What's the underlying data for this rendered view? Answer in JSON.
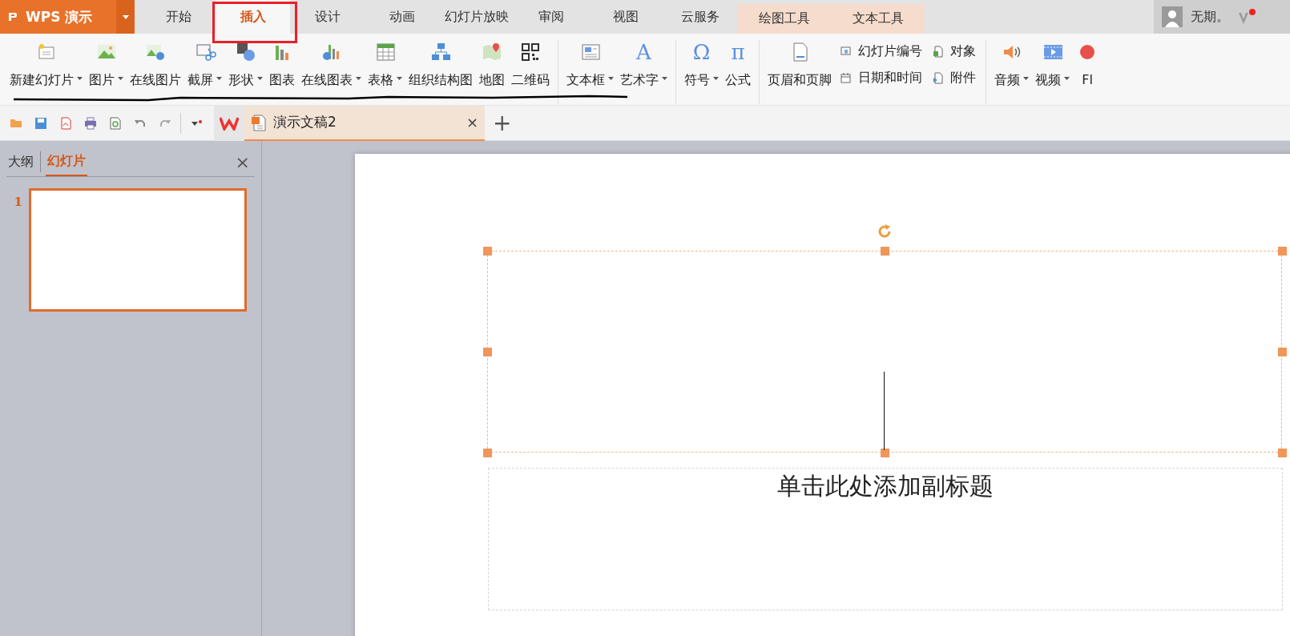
{
  "app": {
    "logo": "WPS 演示"
  },
  "tabs": [
    {
      "label": "开始",
      "selected": false,
      "contextual": false
    },
    {
      "label": "插入",
      "selected": true,
      "contextual": false
    },
    {
      "label": "设计",
      "selected": false,
      "contextual": false
    },
    {
      "label": "动画",
      "selected": false,
      "contextual": false
    },
    {
      "label": "幻灯片放映",
      "selected": false,
      "contextual": false
    },
    {
      "label": "审阅",
      "selected": false,
      "contextual": false
    },
    {
      "label": "视图",
      "selected": false,
      "contextual": false
    },
    {
      "label": "云服务",
      "selected": false,
      "contextual": false
    },
    {
      "label": "绘图工具",
      "selected": false,
      "contextual": true
    },
    {
      "label": "文本工具",
      "selected": false,
      "contextual": true
    }
  ],
  "user": {
    "name": "无期。"
  },
  "ribbon": [
    {
      "items": [
        {
          "kind": "big",
          "label": "新建幻灯片",
          "dropdown": true
        },
        {
          "kind": "big",
          "label": "图片",
          "dropdown": true
        },
        {
          "kind": "big",
          "label": "在线图片",
          "dropdown": false
        },
        {
          "kind": "big",
          "label": "截屏",
          "dropdown": true
        },
        {
          "kind": "big",
          "label": "形状",
          "dropdown": true
        },
        {
          "kind": "big",
          "label": "图表",
          "dropdown": false
        },
        {
          "kind": "big",
          "label": "在线图表",
          "dropdown": true
        },
        {
          "kind": "big",
          "label": "表格",
          "dropdown": true
        },
        {
          "kind": "big",
          "label": "组织结构图",
          "dropdown": false
        },
        {
          "kind": "big",
          "label": "地图",
          "dropdown": false
        },
        {
          "kind": "big",
          "label": "二维码",
          "dropdown": false
        }
      ]
    },
    {
      "items": [
        {
          "kind": "big",
          "label": "文本框",
          "dropdown": true
        },
        {
          "kind": "big",
          "label": "艺术字",
          "dropdown": true,
          "glyph": "A"
        }
      ]
    },
    {
      "items": [
        {
          "kind": "big",
          "label": "符号",
          "dropdown": true,
          "glyph": "Ω"
        },
        {
          "kind": "big",
          "label": "公式",
          "dropdown": false,
          "glyph": "π"
        }
      ]
    },
    {
      "items": [
        {
          "kind": "big",
          "label": "页眉和页脚",
          "dropdown": false
        },
        {
          "kind": "stack",
          "entries": [
            {
              "label": "幻灯片编号"
            },
            {
              "label": "日期和时间"
            }
          ]
        },
        {
          "kind": "stack",
          "entries": [
            {
              "label": "对象"
            },
            {
              "label": "附件"
            }
          ]
        }
      ]
    },
    {
      "items": [
        {
          "kind": "big",
          "label": "音频",
          "dropdown": true
        },
        {
          "kind": "big",
          "label": "视频",
          "dropdown": true
        },
        {
          "kind": "big",
          "label": "Fl",
          "dropdown": false
        }
      ]
    }
  ],
  "document_tab": {
    "title": "演示文稿2",
    "close": "×",
    "new_tab": "+"
  },
  "side_panel": {
    "tabs": [
      {
        "label": "大纲",
        "selected": false
      },
      {
        "label": "幻灯片",
        "selected": true
      }
    ],
    "close": "×",
    "slides": [
      {
        "number": "1",
        "selected": true
      }
    ]
  },
  "slide": {
    "subtitle_placeholder": "单击此处添加副标题"
  }
}
